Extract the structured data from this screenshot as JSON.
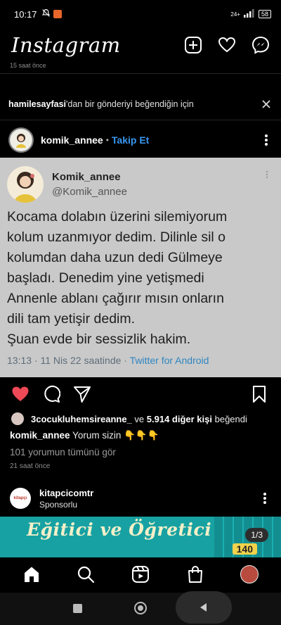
{
  "status": {
    "time": "10:17",
    "battery": "58",
    "signal_label": "24+"
  },
  "header": {
    "logo": "Instagram"
  },
  "prev_post": {
    "time_ago": "15 saat önce"
  },
  "suggestion": {
    "account": "hamilesayfasi",
    "text": "'dan bir gönderiyi beğendiğin için"
  },
  "post": {
    "username": "komik_annee",
    "follow_label": "Takip Et",
    "separator": "•",
    "tweet": {
      "name": "Komik_annee",
      "handle": "@Komik_annee",
      "text": "Kocama dolabın üzerini silemiyorum\nkolum uzanmıyor dedim. Dilinle sil o\nkolumdan daha uzun dedi Gülmeye\nbaşladı. Denedim yine yetişmedi\nAnnenle ablanı çağırır mısın onların\ndili tam yetişir dedim.\nŞuan evde bir sessizlik hakim.",
      "date": "13:13 · 11 Nis 22 saatinde · ",
      "source": "Twitter for Android"
    },
    "liked_by": "3cocukluhemsireanne_",
    "liked_mid": " ve ",
    "liked_count": "5.914 diğer kişi",
    "liked_end": " beğendi",
    "caption_user": "komik_annee",
    "caption_text": " Yorum sizin 👇👇👇",
    "comments_link": "101 yorumun tümünü gör",
    "time_ago": "21 saat önce"
  },
  "sponsored": {
    "account": "kitapcicomtr",
    "label": "Sponsorlu",
    "avatar_text": "kitapçı",
    "ad_title": "Eğitici ve Öğretici",
    "carousel": "1/3",
    "badge_number": "140"
  },
  "colors": {
    "accent": "#3897f0",
    "like": "#ed4956",
    "ad_bg": "#17a1a3"
  },
  "icons": [
    "new-post-icon",
    "heart-icon",
    "messenger-icon",
    "close-icon",
    "more-icon",
    "comment-icon",
    "share-icon",
    "save-icon",
    "home-icon",
    "search-icon",
    "reels-icon",
    "shop-icon"
  ]
}
